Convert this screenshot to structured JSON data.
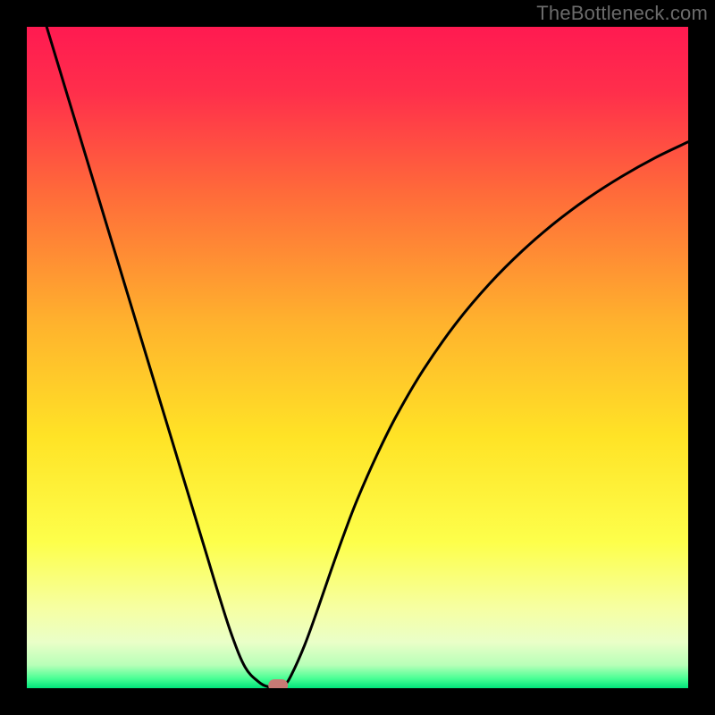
{
  "watermark": "TheBottleneck.com",
  "colors": {
    "frame": "#000000",
    "curve": "#000000",
    "marker": "#c77a75",
    "gradient_stops": [
      {
        "offset": 0.0,
        "color": "#ff1a51"
      },
      {
        "offset": 0.1,
        "color": "#ff2f4b"
      },
      {
        "offset": 0.25,
        "color": "#ff6a3a"
      },
      {
        "offset": 0.45,
        "color": "#ffb32d"
      },
      {
        "offset": 0.62,
        "color": "#ffe326"
      },
      {
        "offset": 0.78,
        "color": "#fdff4b"
      },
      {
        "offset": 0.88,
        "color": "#f6ffa3"
      },
      {
        "offset": 0.93,
        "color": "#eaffc8"
      },
      {
        "offset": 0.965,
        "color": "#b8ffb8"
      },
      {
        "offset": 0.985,
        "color": "#4bff95"
      },
      {
        "offset": 1.0,
        "color": "#00e37a"
      }
    ]
  },
  "chart_data": {
    "type": "line",
    "title": "",
    "xlabel": "",
    "ylabel": "",
    "xlim": [
      0,
      100
    ],
    "ylim": [
      0,
      100
    ],
    "x": [
      3,
      5,
      7,
      9,
      11,
      13,
      15,
      17,
      19,
      21,
      23,
      25,
      27,
      29,
      31,
      33,
      35,
      36.5,
      38,
      39,
      40,
      42,
      44,
      46,
      48,
      50,
      53,
      56,
      60,
      65,
      70,
      75,
      80,
      85,
      90,
      95,
      100
    ],
    "values": [
      100,
      93.4,
      86.8,
      80.2,
      73.6,
      67.0,
      60.4,
      53.8,
      47.2,
      40.6,
      34.0,
      27.4,
      20.8,
      14.2,
      8.0,
      3.2,
      1.0,
      0.2,
      0.0,
      0.5,
      2.0,
      6.5,
      12.0,
      17.8,
      23.4,
      28.6,
      35.4,
      41.4,
      48.2,
      55.3,
      61.2,
      66.2,
      70.5,
      74.2,
      77.4,
      80.2,
      82.6
    ],
    "marker": {
      "x": 38,
      "y": 0
    }
  }
}
